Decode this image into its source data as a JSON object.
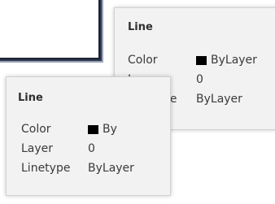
{
  "tooltip_back": {
    "title": "Line",
    "rows": [
      {
        "label": "Color",
        "value": "ByLayer",
        "swatch_color": "#000000"
      },
      {
        "label": "Layer",
        "value": "0"
      },
      {
        "label": "Linetype",
        "value": "ByLayer"
      }
    ]
  },
  "tooltip_front": {
    "title": "Line",
    "rows": [
      {
        "label": "Color",
        "value": "By",
        "swatch_color": "#000000"
      },
      {
        "label": "Layer",
        "value": "0"
      },
      {
        "label": "Linetype",
        "value": "ByLayer"
      }
    ]
  },
  "colors": {
    "tooltip_background": "#f2f2f2",
    "rectangle_stroke": "#1d2130"
  }
}
